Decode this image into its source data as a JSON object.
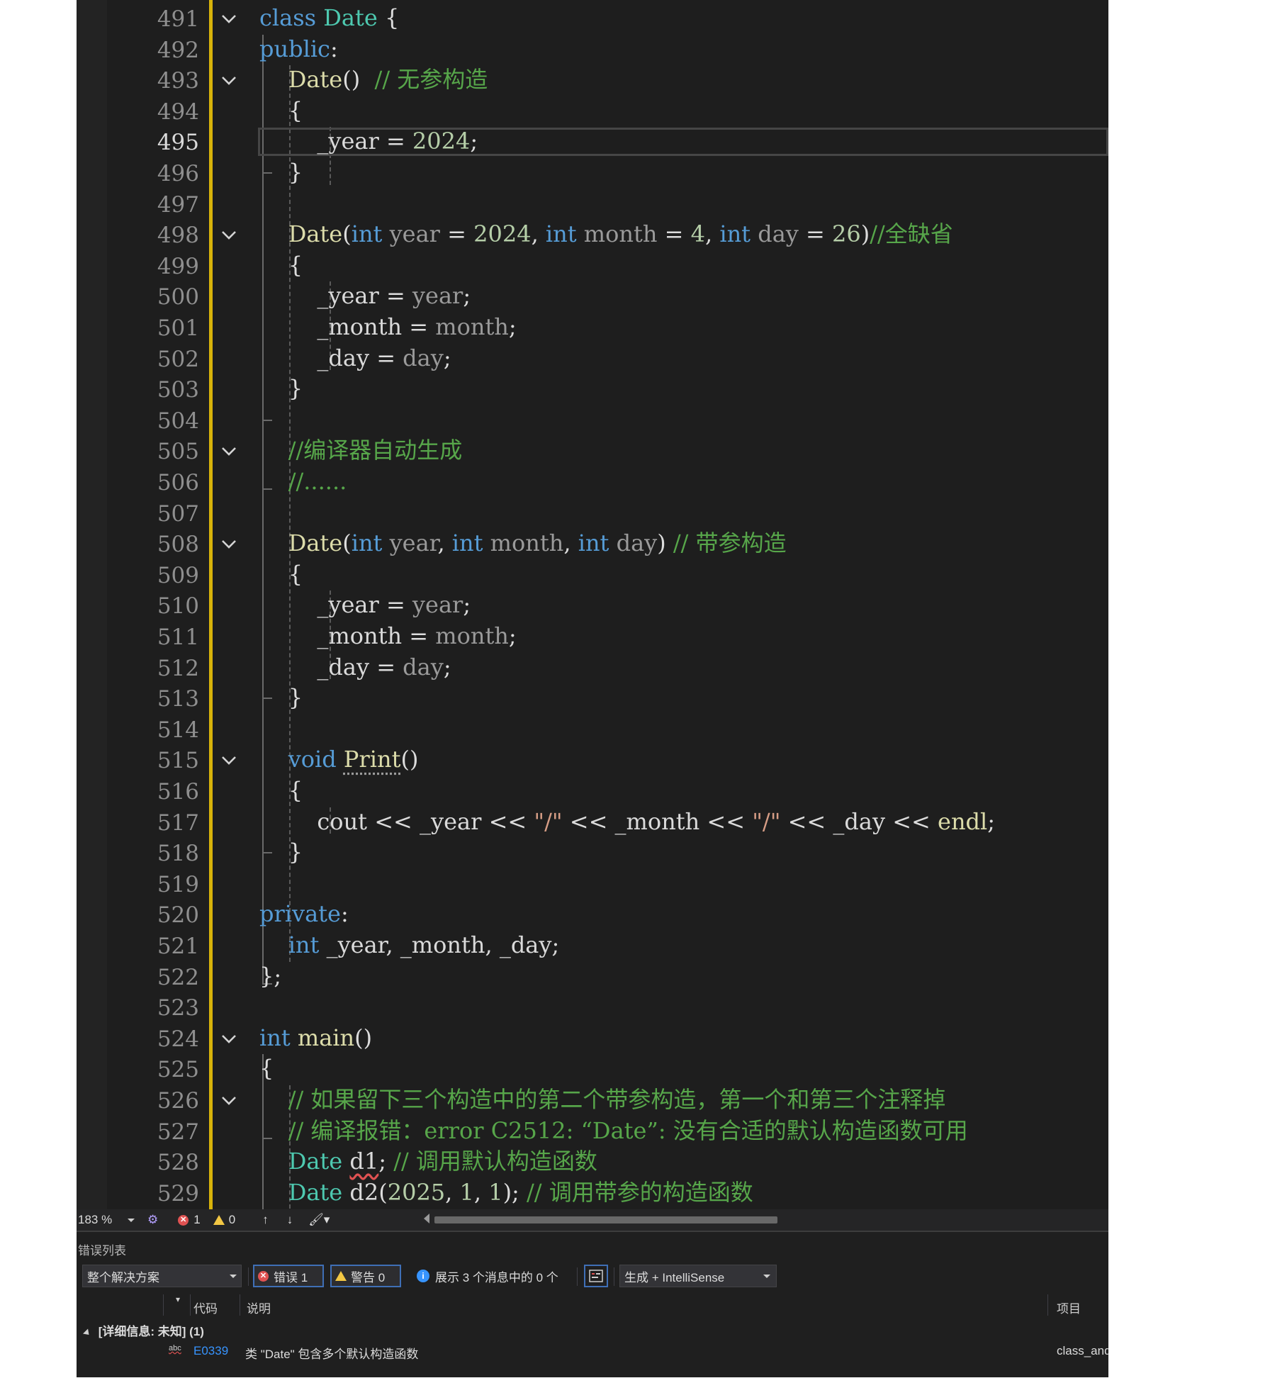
{
  "editor": {
    "current_line": 495,
    "lines": [
      {
        "n": 491,
        "segs": [
          {
            "t": "class ",
            "c": "kw"
          },
          {
            "t": "Date",
            "c": "ty"
          },
          {
            "t": " {",
            "c": ""
          }
        ]
      },
      {
        "n": 492,
        "segs": [
          {
            "t": "public",
            "c": "kw"
          },
          {
            "t": ":",
            "c": ""
          }
        ]
      },
      {
        "n": 493,
        "segs": [
          {
            "t": "    ",
            "c": ""
          },
          {
            "t": "Date",
            "c": "fn"
          },
          {
            "t": "()  ",
            "c": ""
          },
          {
            "t": "// 无参构造",
            "c": "cm"
          }
        ]
      },
      {
        "n": 494,
        "segs": [
          {
            "t": "    {",
            "c": ""
          }
        ]
      },
      {
        "n": 495,
        "segs": [
          {
            "t": "        ",
            "c": ""
          },
          {
            "t": "_year",
            "c": "mem"
          },
          {
            "t": " = ",
            "c": ""
          },
          {
            "t": "2024",
            "c": "num"
          },
          {
            "t": ";",
            "c": ""
          }
        ]
      },
      {
        "n": 496,
        "segs": [
          {
            "t": "    }",
            "c": ""
          }
        ]
      },
      {
        "n": 497,
        "segs": []
      },
      {
        "n": 498,
        "segs": [
          {
            "t": "    ",
            "c": ""
          },
          {
            "t": "Date",
            "c": "fn"
          },
          {
            "t": "(",
            "c": ""
          },
          {
            "t": "int",
            "c": "kw"
          },
          {
            "t": " ",
            "c": ""
          },
          {
            "t": "year",
            "c": "pm"
          },
          {
            "t": " = ",
            "c": ""
          },
          {
            "t": "2024",
            "c": "num"
          },
          {
            "t": ", ",
            "c": ""
          },
          {
            "t": "int",
            "c": "kw"
          },
          {
            "t": " ",
            "c": ""
          },
          {
            "t": "month",
            "c": "pm"
          },
          {
            "t": " = ",
            "c": ""
          },
          {
            "t": "4",
            "c": "num"
          },
          {
            "t": ", ",
            "c": ""
          },
          {
            "t": "int",
            "c": "kw"
          },
          {
            "t": " ",
            "c": ""
          },
          {
            "t": "day",
            "c": "pm"
          },
          {
            "t": " = ",
            "c": ""
          },
          {
            "t": "26",
            "c": "num"
          },
          {
            "t": ")",
            "c": ""
          },
          {
            "t": "//全缺省",
            "c": "cm"
          }
        ]
      },
      {
        "n": 499,
        "segs": [
          {
            "t": "    {",
            "c": ""
          }
        ]
      },
      {
        "n": 500,
        "segs": [
          {
            "t": "        ",
            "c": ""
          },
          {
            "t": "_year",
            "c": "mem"
          },
          {
            "t": " = ",
            "c": ""
          },
          {
            "t": "year",
            "c": "pm"
          },
          {
            "t": ";",
            "c": ""
          }
        ]
      },
      {
        "n": 501,
        "segs": [
          {
            "t": "        ",
            "c": ""
          },
          {
            "t": "_month",
            "c": "mem"
          },
          {
            "t": " = ",
            "c": ""
          },
          {
            "t": "month",
            "c": "pm"
          },
          {
            "t": ";",
            "c": ""
          }
        ]
      },
      {
        "n": 502,
        "segs": [
          {
            "t": "        ",
            "c": ""
          },
          {
            "t": "_day",
            "c": "mem"
          },
          {
            "t": " = ",
            "c": ""
          },
          {
            "t": "day",
            "c": "pm"
          },
          {
            "t": ";",
            "c": ""
          }
        ]
      },
      {
        "n": 503,
        "segs": [
          {
            "t": "    }",
            "c": ""
          }
        ]
      },
      {
        "n": 504,
        "segs": []
      },
      {
        "n": 505,
        "segs": [
          {
            "t": "    ",
            "c": ""
          },
          {
            "t": "//编译器自动生成",
            "c": "cm"
          }
        ]
      },
      {
        "n": 506,
        "segs": [
          {
            "t": "    ",
            "c": ""
          },
          {
            "t": "//......",
            "c": "cm"
          }
        ]
      },
      {
        "n": 507,
        "segs": []
      },
      {
        "n": 508,
        "segs": [
          {
            "t": "    ",
            "c": ""
          },
          {
            "t": "Date",
            "c": "fn"
          },
          {
            "t": "(",
            "c": ""
          },
          {
            "t": "int",
            "c": "kw"
          },
          {
            "t": " ",
            "c": ""
          },
          {
            "t": "year",
            "c": "pm"
          },
          {
            "t": ", ",
            "c": ""
          },
          {
            "t": "int",
            "c": "kw"
          },
          {
            "t": " ",
            "c": ""
          },
          {
            "t": "month",
            "c": "pm"
          },
          {
            "t": ", ",
            "c": ""
          },
          {
            "t": "int",
            "c": "kw"
          },
          {
            "t": " ",
            "c": ""
          },
          {
            "t": "day",
            "c": "pm"
          },
          {
            "t": ") ",
            "c": ""
          },
          {
            "t": "// 带参构造",
            "c": "cm"
          }
        ]
      },
      {
        "n": 509,
        "segs": [
          {
            "t": "    {",
            "c": ""
          }
        ]
      },
      {
        "n": 510,
        "segs": [
          {
            "t": "        ",
            "c": ""
          },
          {
            "t": "_year",
            "c": "mem"
          },
          {
            "t": " = ",
            "c": ""
          },
          {
            "t": "year",
            "c": "pm"
          },
          {
            "t": ";",
            "c": ""
          }
        ]
      },
      {
        "n": 511,
        "segs": [
          {
            "t": "        ",
            "c": ""
          },
          {
            "t": "_month",
            "c": "mem"
          },
          {
            "t": " = ",
            "c": ""
          },
          {
            "t": "month",
            "c": "pm"
          },
          {
            "t": ";",
            "c": ""
          }
        ]
      },
      {
        "n": 512,
        "segs": [
          {
            "t": "        ",
            "c": ""
          },
          {
            "t": "_day",
            "c": "mem"
          },
          {
            "t": " = ",
            "c": ""
          },
          {
            "t": "day",
            "c": "pm"
          },
          {
            "t": ";",
            "c": ""
          }
        ]
      },
      {
        "n": 513,
        "segs": [
          {
            "t": "    }",
            "c": ""
          }
        ]
      },
      {
        "n": 514,
        "segs": []
      },
      {
        "n": 515,
        "segs": [
          {
            "t": "    ",
            "c": ""
          },
          {
            "t": "void",
            "c": "kw"
          },
          {
            "t": " ",
            "c": ""
          },
          {
            "t": "Print",
            "c": "fn dots"
          },
          {
            "t": "()",
            "c": ""
          }
        ]
      },
      {
        "n": 516,
        "segs": [
          {
            "t": "    {",
            "c": ""
          }
        ]
      },
      {
        "n": 517,
        "segs": [
          {
            "t": "        ",
            "c": ""
          },
          {
            "t": "cout",
            "c": "mem"
          },
          {
            "t": " << ",
            "c": ""
          },
          {
            "t": "_year",
            "c": "mem"
          },
          {
            "t": " << ",
            "c": ""
          },
          {
            "t": "\"/\"",
            "c": "str"
          },
          {
            "t": " << ",
            "c": ""
          },
          {
            "t": "_month",
            "c": "mem"
          },
          {
            "t": " << ",
            "c": ""
          },
          {
            "t": "\"/\"",
            "c": "str"
          },
          {
            "t": " << ",
            "c": ""
          },
          {
            "t": "_day",
            "c": "mem"
          },
          {
            "t": " << ",
            "c": ""
          },
          {
            "t": "endl",
            "c": "fn"
          },
          {
            "t": ";",
            "c": ""
          }
        ]
      },
      {
        "n": 518,
        "segs": [
          {
            "t": "    }",
            "c": ""
          }
        ]
      },
      {
        "n": 519,
        "segs": []
      },
      {
        "n": 520,
        "segs": [
          {
            "t": "private",
            "c": "kw"
          },
          {
            "t": ":",
            "c": ""
          }
        ]
      },
      {
        "n": 521,
        "segs": [
          {
            "t": "    ",
            "c": ""
          },
          {
            "t": "int",
            "c": "kw"
          },
          {
            "t": " _year, _month, _day;",
            "c": "mem"
          }
        ]
      },
      {
        "n": 522,
        "segs": [
          {
            "t": "};",
            "c": ""
          }
        ]
      },
      {
        "n": 523,
        "segs": []
      },
      {
        "n": 524,
        "segs": [
          {
            "t": "int",
            "c": "kw"
          },
          {
            "t": " ",
            "c": ""
          },
          {
            "t": "main",
            "c": "fn"
          },
          {
            "t": "()",
            "c": ""
          }
        ]
      },
      {
        "n": 525,
        "segs": [
          {
            "t": "{",
            "c": ""
          }
        ]
      },
      {
        "n": 526,
        "segs": [
          {
            "t": "    ",
            "c": ""
          },
          {
            "t": "// 如果留下三个构造中的第二个带参构造，第一个和第三个注释掉",
            "c": "cm"
          }
        ]
      },
      {
        "n": 527,
        "segs": [
          {
            "t": "    ",
            "c": ""
          },
          {
            "t": "// 编译报错：error C2512: “Date”: 没有合适的默认构造函数可用",
            "c": "cm"
          }
        ]
      },
      {
        "n": 528,
        "segs": [
          {
            "t": "    ",
            "c": ""
          },
          {
            "t": "Date",
            "c": "ty"
          },
          {
            "t": " ",
            "c": ""
          },
          {
            "t": "d1",
            "c": "mem squig"
          },
          {
            "t": "; ",
            "c": ""
          },
          {
            "t": "// 调用默认构造函数",
            "c": "cm"
          }
        ]
      },
      {
        "n": 529,
        "segs": [
          {
            "t": "    ",
            "c": ""
          },
          {
            "t": "Date",
            "c": "ty"
          },
          {
            "t": " ",
            "c": ""
          },
          {
            "t": "d2",
            "c": "mem"
          },
          {
            "t": "(",
            "c": ""
          },
          {
            "t": "2025",
            "c": "num"
          },
          {
            "t": ", ",
            "c": ""
          },
          {
            "t": "1",
            "c": "num"
          },
          {
            "t": ", ",
            "c": ""
          },
          {
            "t": "1",
            "c": "num"
          },
          {
            "t": "); ",
            "c": ""
          },
          {
            "t": "// 调用带参的构造函数",
            "c": "cm"
          }
        ]
      }
    ],
    "fold_lines": [
      491,
      493,
      498,
      505,
      508,
      515,
      524,
      526
    ]
  },
  "status_bar": {
    "zoom": "183 %",
    "errors": "1",
    "warnings": "0"
  },
  "error_list": {
    "title": "错误列表",
    "scope": "整个解决方案",
    "errors_label": "错误 1",
    "warnings_label": "警告 0",
    "messages_label": "展示 3 个消息中的 0 个",
    "source": "生成 + IntelliSense",
    "columns": {
      "code": "代码",
      "description": "说明",
      "project": "项目"
    },
    "group": "[详细信息: 未知]  (1)",
    "rows": [
      {
        "code": "E0339",
        "description": "类 \"Date\" 包含多个默认构造函数",
        "project": "class_and"
      }
    ]
  },
  "colors": {
    "background": "#1e1e1e",
    "keyword": "#569cd6",
    "type": "#4ec9b0",
    "function": "#dcdcaa",
    "number": "#b5cea8",
    "string": "#d69d85",
    "comment": "#57a64a",
    "change_bar": "#d8b30a"
  }
}
